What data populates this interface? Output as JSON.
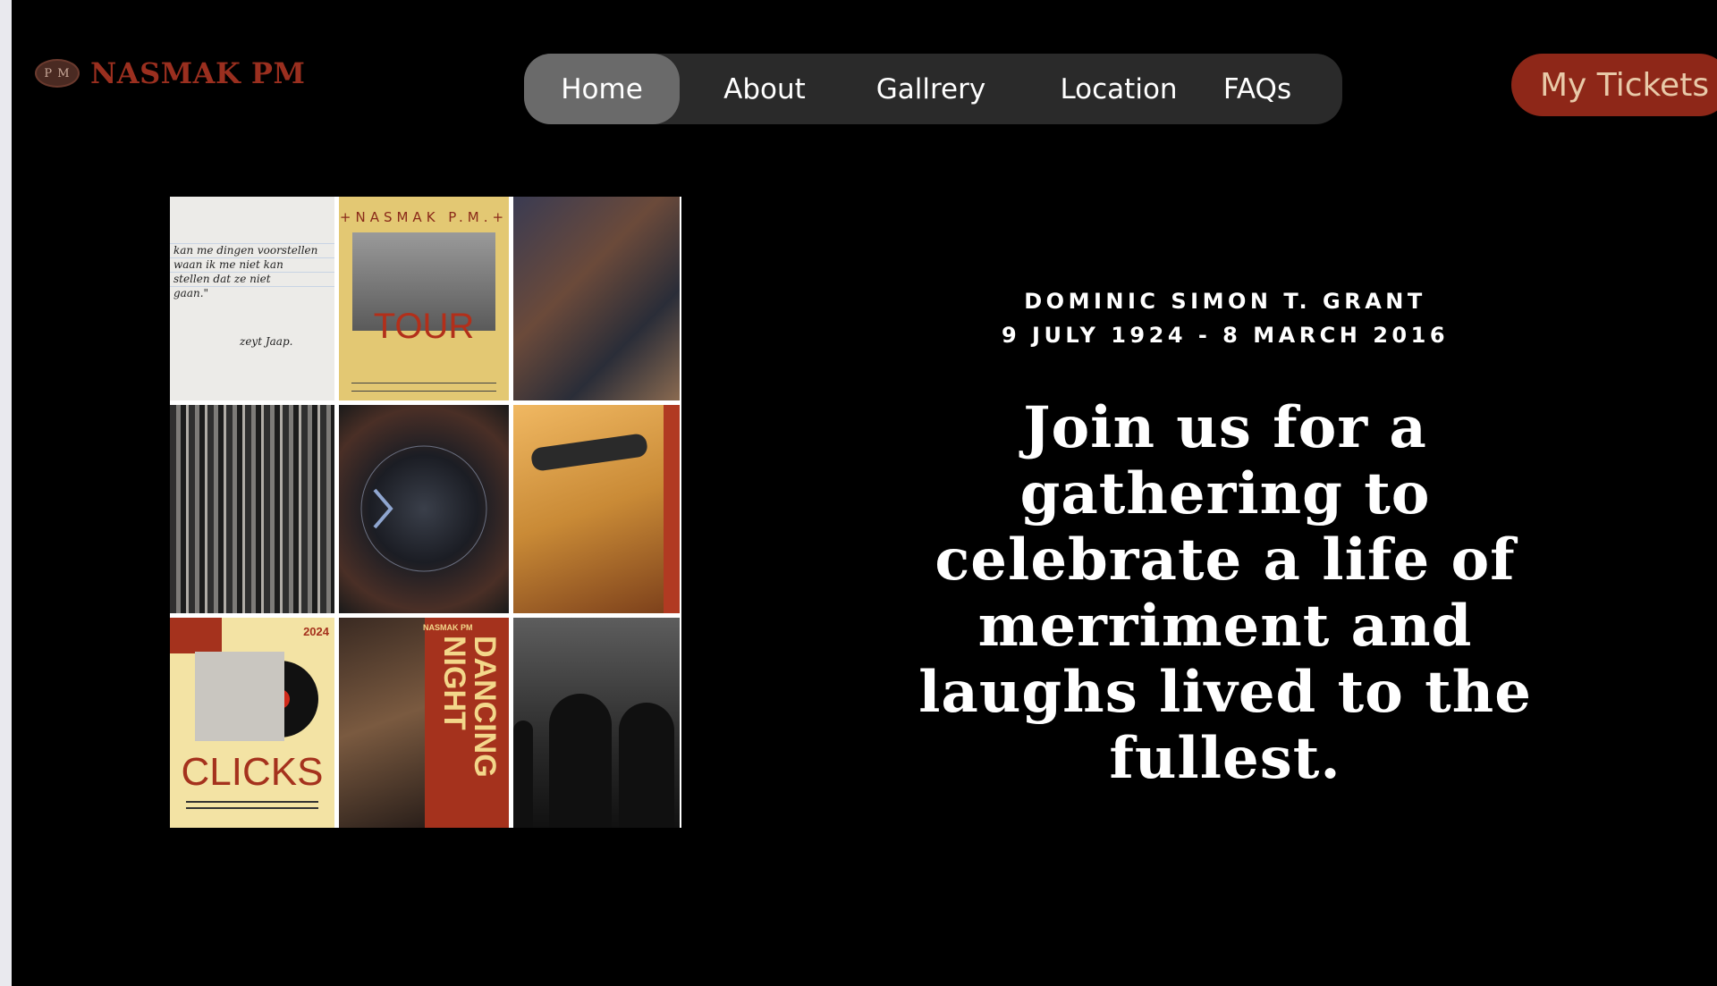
{
  "logo": {
    "badge": "P M",
    "text": "NASMAK PM"
  },
  "nav": {
    "items": [
      {
        "label": "Home",
        "active": true
      },
      {
        "label": "About"
      },
      {
        "label": "Gallrery"
      },
      {
        "label": "Location"
      },
      {
        "label": "FAQs"
      }
    ]
  },
  "tickets_label": "My Tickets",
  "collage": {
    "note": [
      "kan me dingen voorstellen",
      "waan ik me niet kan",
      "stellen dat ze niet",
      "gaan.\"",
      "zeyt Jaap."
    ],
    "poster_title": "+NASMAK P.M.+",
    "poster_word": "TOUR",
    "clicks_year": "2024",
    "clicks_word": "CLICKS",
    "dance_brand": "NASMAK PM",
    "dance_word": "DANCING NIGHT"
  },
  "memorial": {
    "name": "DOMINIC SIMON T. GRANT",
    "dates": "9 JULY 1924 - 8 MARCH 2016"
  },
  "headline": "Join us for a gathering to celebrate a life of merriment and laughs lived to the fullest.",
  "colors": {
    "brand_red": "#8e2718",
    "nav_bg": "#2a2a2a",
    "nav_active": "#6a6a6a"
  }
}
